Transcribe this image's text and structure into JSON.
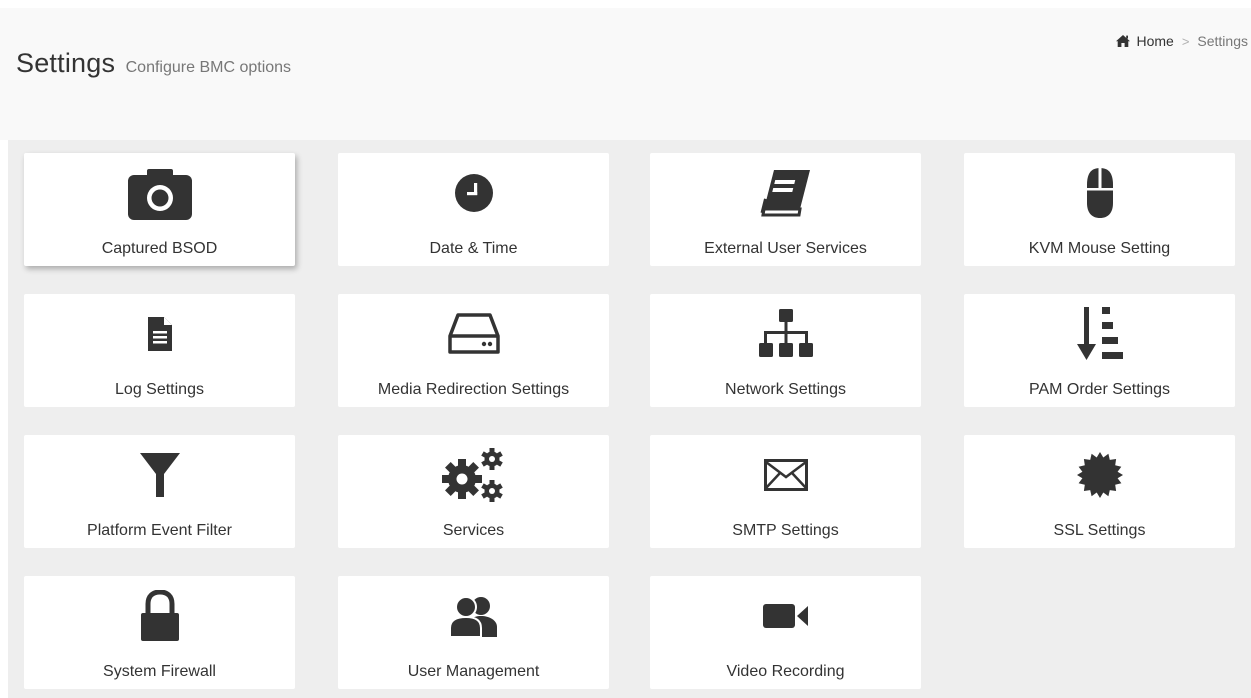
{
  "header": {
    "title": "Settings",
    "subtitle": "Configure BMC options",
    "breadcrumb": {
      "home": "Home",
      "separator": ">",
      "current": "Settings"
    }
  },
  "tiles": [
    {
      "label": "Captured BSOD",
      "icon": "camera-icon",
      "active": true
    },
    {
      "label": "Date & Time",
      "icon": "clock-icon"
    },
    {
      "label": "External User Services",
      "icon": "book-icon"
    },
    {
      "label": "KVM Mouse Setting",
      "icon": "mouse-icon"
    },
    {
      "label": "Log Settings",
      "icon": "document-icon"
    },
    {
      "label": "Media Redirection Settings",
      "icon": "hard-drive-icon"
    },
    {
      "label": "Network Settings",
      "icon": "sitemap-icon"
    },
    {
      "label": "PAM Order Settings",
      "icon": "sort-order-icon"
    },
    {
      "label": "Platform Event Filter",
      "icon": "filter-icon"
    },
    {
      "label": "Services",
      "icon": "gears-icon"
    },
    {
      "label": "SMTP Settings",
      "icon": "envelope-icon"
    },
    {
      "label": "SSL Settings",
      "icon": "certificate-icon"
    },
    {
      "label": "System Firewall",
      "icon": "lock-icon"
    },
    {
      "label": "User Management",
      "icon": "users-icon"
    },
    {
      "label": "Video Recording",
      "icon": "video-camera-icon"
    }
  ],
  "colors": {
    "icon": "#333333",
    "text": "#333333",
    "muted": "#777777",
    "panel_bg": "#eeeeee",
    "header_bg": "#f9f9f9",
    "tile_bg": "#ffffff"
  }
}
